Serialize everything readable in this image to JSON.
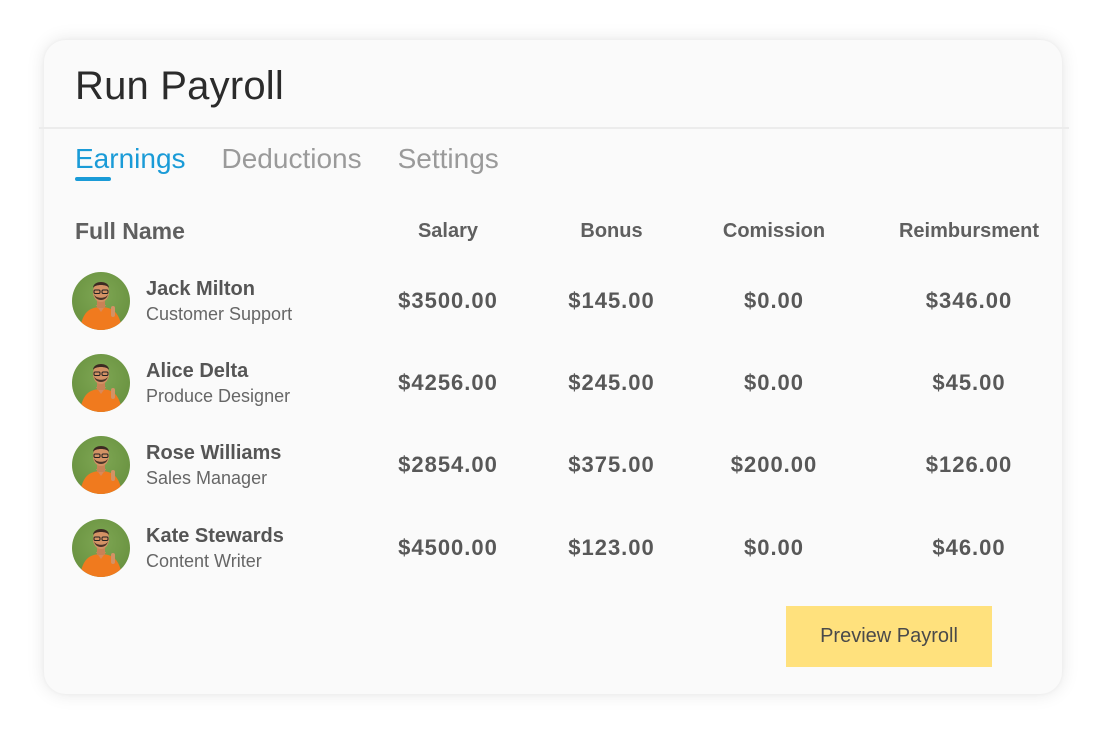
{
  "card": {
    "title": "Run Payroll"
  },
  "tabs": [
    {
      "label": "Earnings",
      "active": true
    },
    {
      "label": "Deductions",
      "active": false
    },
    {
      "label": "Settings",
      "active": false
    }
  ],
  "table": {
    "headers": {
      "name": "Full Name",
      "salary": "Salary",
      "bonus": "Bonus",
      "commission": "Comission",
      "reimbursement": "Reimbursment"
    },
    "rows": [
      {
        "name": "Jack Milton",
        "role": "Customer Support",
        "salary": "$3500.00",
        "bonus": "$145.00",
        "commission": "$0.00",
        "reimbursement": "$346.00"
      },
      {
        "name": "Alice Delta",
        "role": "Produce Designer",
        "salary": "$4256.00",
        "bonus": "$245.00",
        "commission": "$0.00",
        "reimbursement": "$45.00"
      },
      {
        "name": "Rose Williams",
        "role": "Sales Manager",
        "salary": "$2854.00",
        "bonus": "$375.00",
        "commission": "$200.00",
        "reimbursement": "$126.00"
      },
      {
        "name": "Kate Stewards",
        "role": "Content Writer",
        "salary": "$4500.00",
        "bonus": "$123.00",
        "commission": "$0.00",
        "reimbursement": "$46.00"
      }
    ]
  },
  "actions": {
    "preview_label": "Preview Payroll"
  },
  "colors": {
    "accent": "#1a9bd7",
    "button": "#ffe17d",
    "avatar_bg": "#6b9442",
    "shirt": "#f07a1e"
  }
}
